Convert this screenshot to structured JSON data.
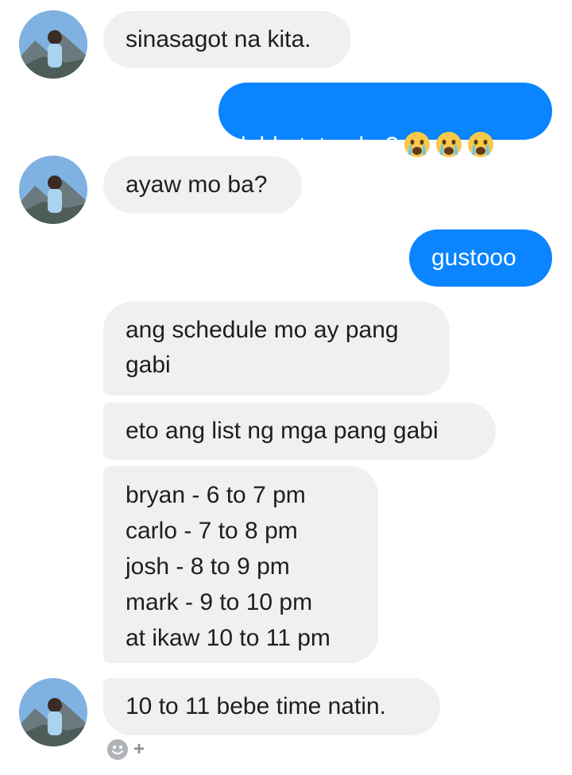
{
  "conversation": {
    "messages": [
      {
        "from": "them",
        "text": "sinasagot na kita."
      },
      {
        "from": "me",
        "text": "lohh, totoo ba?",
        "emojis": [
          "crying-face-emoji",
          "crying-face-emoji",
          "crying-face-emoji"
        ]
      },
      {
        "from": "them",
        "text": "ayaw mo ba?"
      },
      {
        "from": "me",
        "text": "gustooo"
      },
      {
        "from": "them",
        "text": "ang schedule mo ay pang\ngabi"
      },
      {
        "from": "them",
        "text": "eto ang list ng mga pang gabi"
      },
      {
        "from": "them",
        "text": "bryan - 6 to 7 pm\ncarlo - 7 to 8 pm\njosh - 8 to 9 pm\nmark - 9 to 10 pm\nat ikaw 10 to 11 pm"
      },
      {
        "from": "them",
        "text": "10 to 11 bebe time natin."
      }
    ]
  },
  "reaction_button": {
    "icon": "smiley-face-icon",
    "plus": "+"
  },
  "colors": {
    "incoming_bubble": "#f1f0f0",
    "outgoing_bubble": "#0a84ff",
    "outgoing_text": "#ffffff"
  }
}
